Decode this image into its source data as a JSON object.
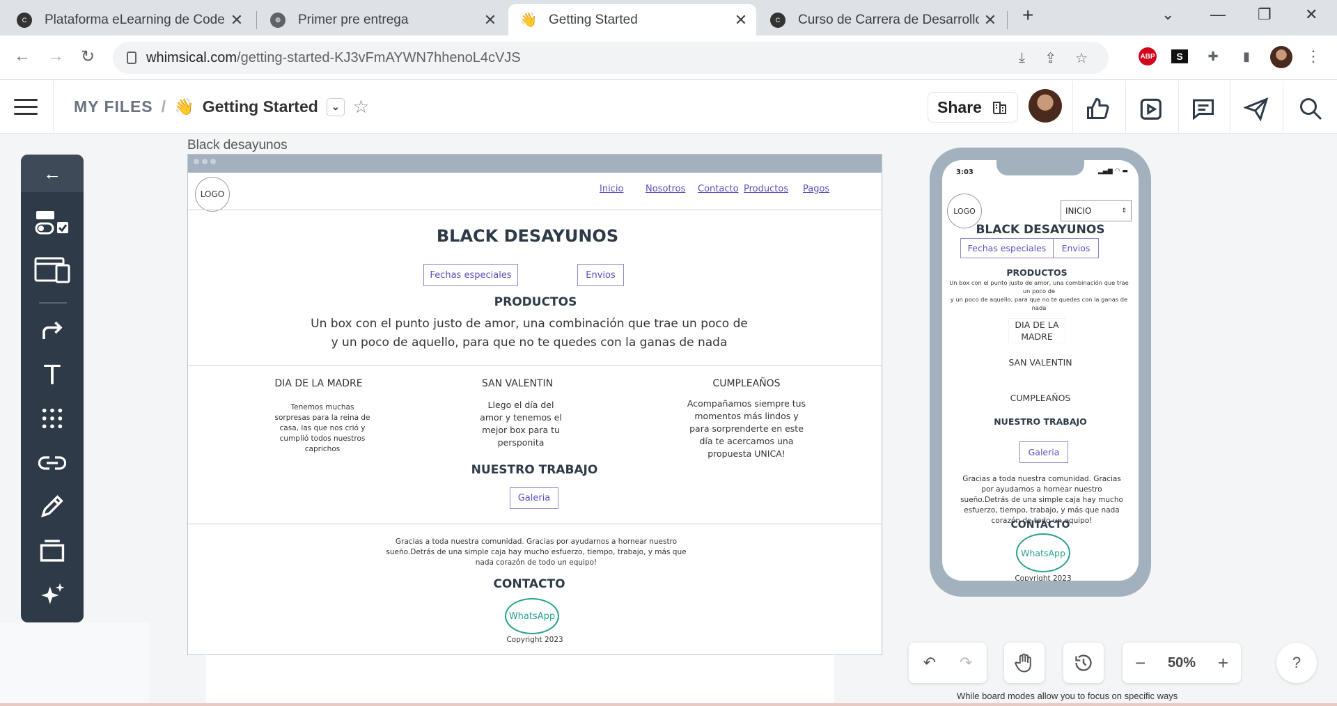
{
  "browser": {
    "tabs": [
      {
        "title": "Plataforma eLearning de Coderh",
        "icon": "coder-icon"
      },
      {
        "title": "Primer pre entrega",
        "icon": "globe-icon"
      },
      {
        "title": "Getting Started",
        "icon": "wave-icon",
        "active": true
      },
      {
        "title": "Curso de Carrera de Desarrollo F",
        "icon": "coder-icon"
      }
    ],
    "url_domain": "whimsical.com",
    "url_path": "/getting-started-KJ3vFmAYWN7hhenoL4cVJS"
  },
  "app": {
    "my_files": "MY FILES",
    "separator": "/",
    "doc_emoji": "👋",
    "doc_title": "Getting Started",
    "share": "Share",
    "zoom": "50%",
    "help": "?",
    "hint": "While board modes allow you to focus on specific ways of"
  },
  "desktop": {
    "frame_title": "Black desayunos",
    "logo": "LOGO",
    "nav": [
      "Inicio",
      "Nosotros",
      "Contacto",
      "Productos",
      "Pagos"
    ],
    "heading": "BLACK DESAYUNOS",
    "btn_fechas": "Fechas especiales",
    "btn_envios": "Envios",
    "productos": "PRODUCTOS",
    "productos_line1": "Un box con el punto justo de amor, una combinación que trae un poco de",
    "productos_line2": "y un poco de aquello, para que no te quedes con la ganas de nada",
    "cards": [
      {
        "title": "DIA DE LA MADRE",
        "text": "Tenemos muchas sorpresas para la reina de casa, las que nos crió y cumplió todos nuestros caprichos"
      },
      {
        "title": "SAN VALENTIN",
        "text": "Llego el día del amor y tenemos el mejor box para tu persponita"
      },
      {
        "title": "CUMPLEAÑOS",
        "text": "Acompañamos siempre tus momentos más lindos y para sorprenderte en este día te acercamos una propuesta UNICA!"
      }
    ],
    "nuestro_trabajo": "NUESTRO TRABAJO",
    "galeria": "Galeria",
    "gracias": "Gracias a toda nuestra comunidad. Gracias por ayudarnos a hornear nuestro sueño.Detrás de una simple caja hay mucho esfuerzo, tiempo, trabajo, y más que nada corazón de todo un equipo!",
    "contacto": "CONTACTO",
    "whatsapp": "WhatsApp",
    "copyright": "Copyright 2023"
  },
  "mobile": {
    "time": "3:03",
    "logo": "LOGO",
    "select": "INICIO",
    "heading": "BLACK DESAYUNOS",
    "btn_fechas": "Fechas especiales",
    "btn_envios": "Envios",
    "productos": "PRODUCTOS",
    "productos_line1": "Un box con el punto justo de amor, una combinación que trae un poco de",
    "productos_line2": "y un poco de aquello, para que no te quedes con la ganas de nada",
    "cards": [
      "DIA DE LA MADRE",
      "SAN VALENTIN",
      "CUMPLEAÑOS"
    ],
    "nuestro_trabajo": "NUESTRO TRABAJO",
    "galeria": "Galeria",
    "gracias": "Gracias a toda nuestra comunidad. Gracias por ayudarnos a hornear nuestro sueño.Detrás de una simple caja hay mucho esfuerzo, tiempo, trabajo, y más que nada corazón de todo un equipo!",
    "contacto": "CONTACTO",
    "whatsapp": "WhatsApp",
    "copyright": "Copyright 2023"
  }
}
